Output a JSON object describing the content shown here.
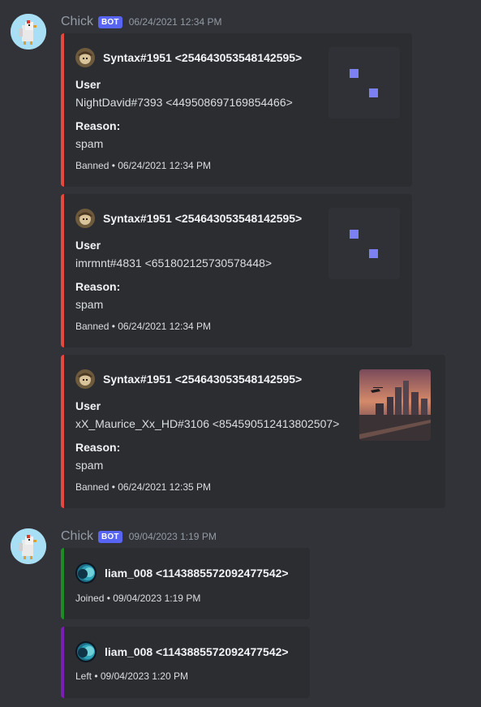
{
  "messages": [
    {
      "author": "Chick",
      "bot_tag": "BOT",
      "timestamp": "06/24/2021 12:34 PM",
      "embeds": [
        {
          "color": "#e5483f",
          "author": "Syntax#1951 <254643053548142595>",
          "field1_name": "User",
          "field1_value": "NightDavid#7393 <449508697169854466>",
          "field2_name": "Reason:",
          "field2_value": "spam",
          "footer": "Banned • 06/24/2021 12:34 PM"
        },
        {
          "color": "#e5483f",
          "author": "Syntax#1951 <254643053548142595>",
          "field1_name": "User",
          "field1_value": "imrmnt#4831 <651802125730578448>",
          "field2_name": "Reason:",
          "field2_value": "spam",
          "footer": "Banned • 06/24/2021 12:34 PM"
        },
        {
          "color": "#e5483f",
          "author": "Syntax#1951 <254643053548142595>",
          "field1_name": "User",
          "field1_value": "xX_Maurice_Xx_HD#3106 <854590512413802507>",
          "field2_name": "Reason:",
          "field2_value": "spam",
          "footer": "Banned • 06/24/2021 12:35 PM"
        }
      ]
    },
    {
      "author": "Chick",
      "bot_tag": "BOT",
      "timestamp": "09/04/2023 1:19 PM",
      "embeds": [
        {
          "color": "#1f8b24",
          "author": "liam_008 <1143885572092477542>",
          "footer": "Joined • 09/04/2023 1:19 PM"
        },
        {
          "color": "#7b1fb3",
          "author": "liam_008 <1143885572092477542>",
          "footer": "Left • 09/04/2023 1:20 PM"
        }
      ]
    }
  ],
  "colors": {
    "background": "#313338",
    "embed_bg": "#2b2d31",
    "bot_tag": "#5865f2"
  },
  "icons": {
    "bot_avatar": "chicken-avatar",
    "embed_author_syntax": "syntax-avatar",
    "embed_author_liam": "planet-avatar",
    "thumbnail_1": "pixel-gif-thumbnail",
    "thumbnail_2": "pixel-gif-thumbnail",
    "thumbnail_3": "city-sunset-thumbnail"
  }
}
